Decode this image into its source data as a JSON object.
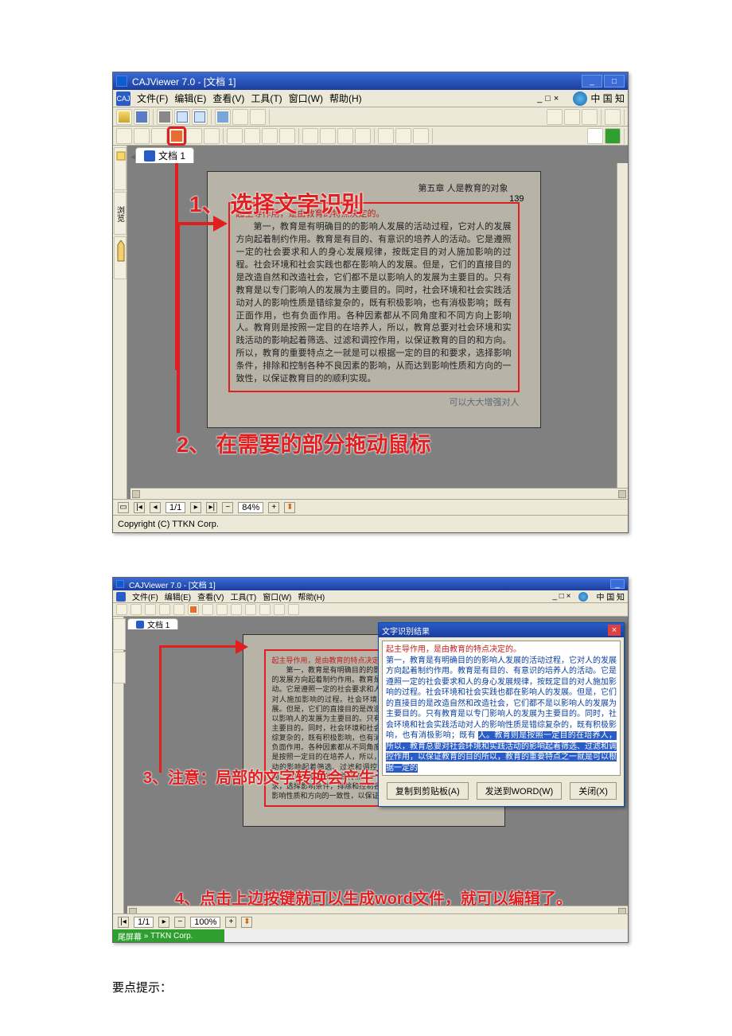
{
  "tip_text": "要点提示：",
  "window": {
    "title": "CAJViewer 7.0 - [文档 1]",
    "menu": [
      "文件(F)",
      "编辑(E)",
      "查看(V)",
      "工具(T)",
      "窗口(W)",
      "帮助(H)"
    ],
    "cnki_text": "中 国 知",
    "close": "×",
    "min": "_",
    "max": "□"
  },
  "tabs": {
    "doc1": "文档 1"
  },
  "sidetabs": {
    "outline": "浏览"
  },
  "document": {
    "chapter": "第五章  人是教育的对象",
    "pageno": "139",
    "selection": [
      "起主导作用，是由教育的特点决定的。",
      "第一，教育是有明确目的的影响人发展的活动过程，它对人的发展方向起着制约作用。教育是有目的、有意识的培养人的活动。它是遵照一定的社会要求和人的身心发展规律，按既定目的对人施加影响的过程。社会环境和社会实践也都在影响人的发展。但是，它们的直接目的是改造自然和改造社会，它们都不是以影响人的发展为主要目的。只有教育是以专门影响人的发展为主要目的。同时，社会环境和社会实践活动对人的影响性质是错综复杂的，既有积极影响，也有消极影响；既有正面作用，也有负面作用。各种因素都从不同角度和不同方向上影响人。教育则是按照一定目的在培养人，所以，教育总要对社会环境和实践活动的影响起着筛选、过滤和调控作用，以保证教育的目的和方向。所以，教育的重要特点之一就是可以根据一定的目的和要求，选择影响条件，排除和控制各种不良因素的影响，从而达到影响性质和方向的一致性，以保证教育目的的顺利实现。"
    ],
    "after": "",
    "after2": "可以大大增强对人"
  },
  "annotations": {
    "a1": "1、 选择文字识别",
    "a2": "2、 在需要的部分拖动鼠标",
    "a3": "3、注意：局部的文字转换会产生误差，需要校对。",
    "a4": "4、点击上边按键就可以生成word文件，就可以编辑了。"
  },
  "status": {
    "page": "1/1",
    "zoom1": "84%",
    "zoom2": "100%"
  },
  "copyright": "Copyright (C) TTKN Corp.",
  "copyright2": "TTKN Corp.",
  "nav_label": "尾屏幕",
  "ocr": {
    "title": "文字识别结果",
    "body_red": "起主导作用，是由教育的特点决定的。",
    "body": "第一，教育是有明确目的的影响人发展的活动过程，它对人的发展方向起着制约作用。教育是有目的、有意识的培养人的活动。它是遵照一定的社会要求和人的身心发展规律，按既定目的对人施加影响的过程。社会环境和社会实践也都在影响人的发展。但是，它们的直接目的是改造自然和改造社会，它们都不是以影响人的发展为主要目的。只有教育是以专门影响人的发展为主要目的。同时，社会环境和社会实践活动对人的影响性质是错综复杂的，既有积极影响，也有消极影响；既有",
    "body_hl": "人。教育则是按照一定目的在培养人，所以，教育总要对社会环境和实践活动的影响起着筛选、过滤和调控作用，以保证教育的目的所以，教育的重要特点之一就是可以根据一定的",
    "btn_copy": "复制到剪贴板(A)",
    "btn_word": "发送到WORD(W)",
    "btn_close": "关闭(X)"
  }
}
